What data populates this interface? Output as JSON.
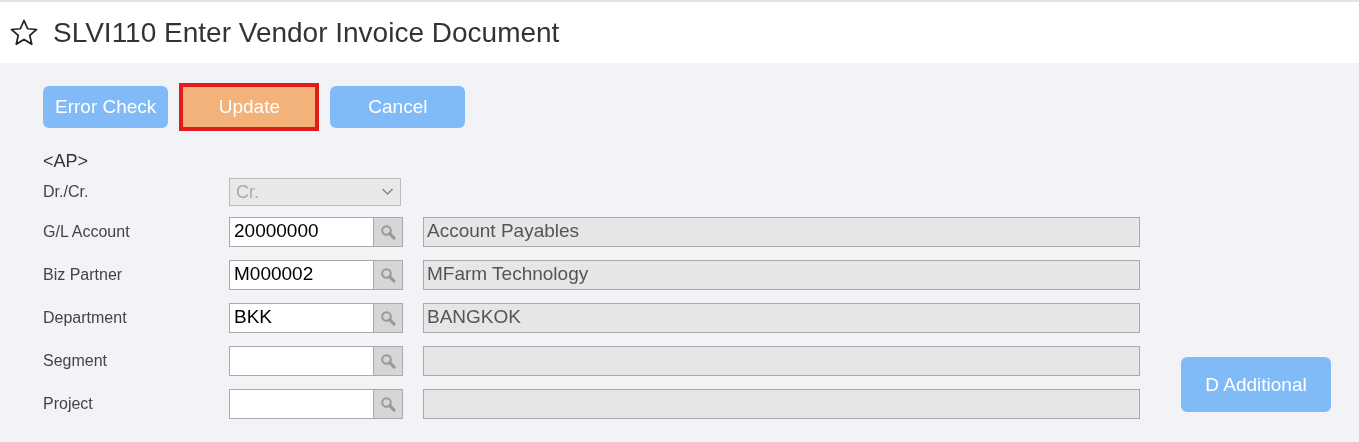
{
  "header": {
    "title": "SLVI110 Enter Vendor Invoice Document",
    "favorite": false
  },
  "buttons": [
    {
      "label": "Error Check",
      "kind": "primary",
      "highlighted": false
    },
    {
      "label": "Update",
      "kind": "accent",
      "highlighted": true
    },
    {
      "label": "Cancel",
      "kind": "primary",
      "highlighted": false
    }
  ],
  "section": "<AP>",
  "dr_cr": {
    "label": "Dr./Cr.",
    "value": "Cr.",
    "disabled": true
  },
  "fields": [
    {
      "label": "G/L Account",
      "code": "20000000",
      "description": "Account Payables"
    },
    {
      "label": "Biz Partner",
      "code": "M000002",
      "description": "MFarm Technology"
    },
    {
      "label": "Department",
      "code": "BKK",
      "description": "BANGKOK"
    },
    {
      "label": "Segment"
    },
    {
      "label": "Project"
    }
  ],
  "side_button": {
    "label": "D Additional"
  }
}
